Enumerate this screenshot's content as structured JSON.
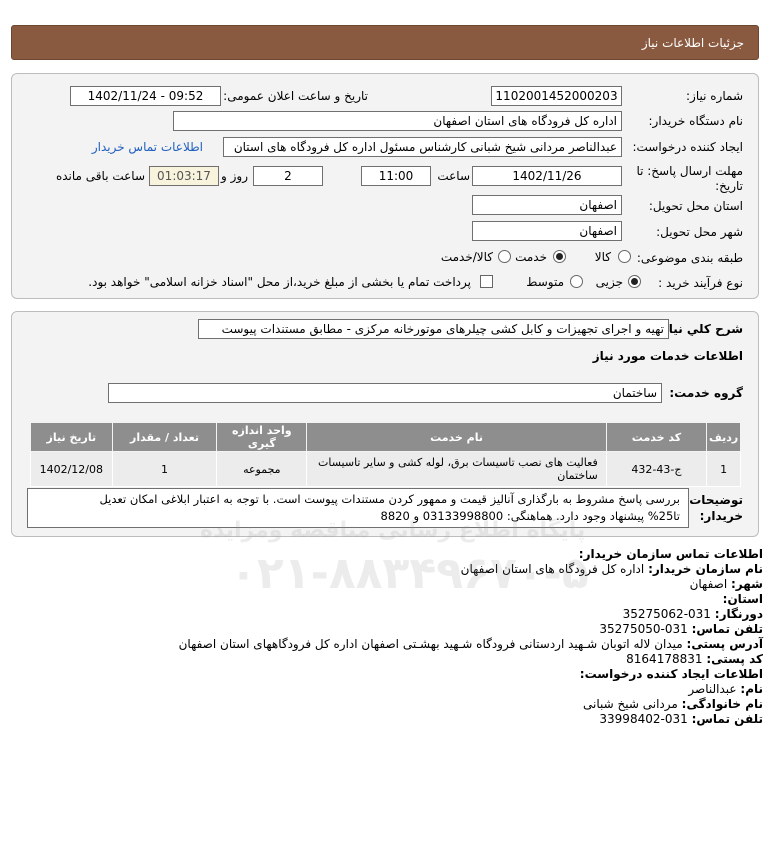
{
  "header": {
    "title": "جزئیات اطلاعات نیاز"
  },
  "fields": {
    "need_number_label": "شماره نیاز:",
    "need_number": "1102001452000203",
    "announce_label": "تاریخ و ساعت اعلان عمومی:",
    "announce_value": "1402/11/24 - 09:52",
    "buyer_org_label": "نام دستگاه خریدار:",
    "buyer_org": "اداره کل فرودگاه های استان اصفهان",
    "requester_label": "ایجاد کننده درخواست:",
    "requester": "عبدالناصر مردانی شیخ شبانی کارشناس مسئول  اداره کل فرودگاه های استان",
    "contact_link": "اطلاعات تماس خریدار",
    "deadline_label": "مهلت ارسال پاسخ: تا تاریخ:",
    "deadline_date": "1402/11/26",
    "time_label": "ساعت",
    "deadline_time": "11:00",
    "days": "2",
    "days_label": "روز و",
    "remaining": "01:03:17",
    "remaining_label": "ساعت باقی مانده",
    "province_label": "استان محل تحویل:",
    "province": "اصفهان",
    "city_label": "شهر محل تحویل:",
    "city": "اصفهان",
    "category_label": "طبقه بندی موضوعی:",
    "category_options": [
      "کالا",
      "خدمت",
      "کالا/خدمت"
    ],
    "category_selected": "خدمت",
    "process_label": "نوع فرآیند خرید :",
    "process_options": [
      "جزیی",
      "متوسط"
    ],
    "process_selected": "جزیی",
    "payment_note": "پرداخت تمام یا بخشی از مبلغ خرید،از محل \"اسناد خزانه اسلامی\" خواهد بود."
  },
  "description": {
    "label": "شرح کلي نياز:",
    "value": "تهیه و اجرای تجهیزات و کابل کشی چیلرهای موتورخانه مرکزی - مطابق مستندات پیوست"
  },
  "services": {
    "section_title": "اطلاعات خدمات مورد نياز",
    "group_label": "گروه خدمت:",
    "group_value": "ساختمان",
    "columns": [
      "ردیف",
      "کد خدمت",
      "نام خدمت",
      "واحد اندازه گیری",
      "تعداد / مقدار",
      "تاریخ نیاز"
    ],
    "rows": [
      [
        "1",
        "ج-43-432",
        "فعالیت های نصب تاسیسات برق، لوله کشی و سایر تاسیسات ساختمان",
        "مجموعه",
        "1",
        "1402/12/08"
      ]
    ]
  },
  "buyer_notes": {
    "label": "توضیحات خریدار:",
    "line1": "بررسی پاسخ مشروط به بارگذاری آنالیز قیمت و ممهور کردن مستندات پیوست است. با توجه به اعتبار ابلاغی امکان تعدیل",
    "line2": "تا25% پیشنهاد وجود دارد. هماهنگی: 03133998800 و 8820"
  },
  "contact": {
    "title": "اطلاعات تماس سازمان خریدار:",
    "org_label": "نام سازمان خریدار:",
    "org": "اداره کل فرودگاه های استان اصفهان",
    "city_label": "شهر:",
    "city": "اصفهان",
    "province_label": "استان:",
    "province": "",
    "fax_label": "دورنگار:",
    "fax": "031-35275062",
    "phone_label": "تلفن تماس:",
    "phone": "031-35275050",
    "address_label": "آدرس پستی:",
    "address": "میدان لاله اتوبان شـهید اردستانی فرودگاه شـهید بهشـتی اصفهان اداره کل فرودگاههای استان اصفهان",
    "postal_label": "کد پستی:",
    "postal": "8164178831",
    "creator_title": "اطلاعات ایجاد کننده درخواست:",
    "name_label": "نام:",
    "name": "عبدالناصر",
    "family_label": "نام خانوادگی:",
    "family": "مردانی شیخ شبانی",
    "creator_phone_label": "تلفن تماس:",
    "creator_phone": "031-33998402"
  },
  "watermark": {
    "text1": "پایگاه اطلاع رسانی مناقصه ومزایده",
    "text2": "۰۲۱-۸۸۳۴۹۶۷۰-۵"
  }
}
